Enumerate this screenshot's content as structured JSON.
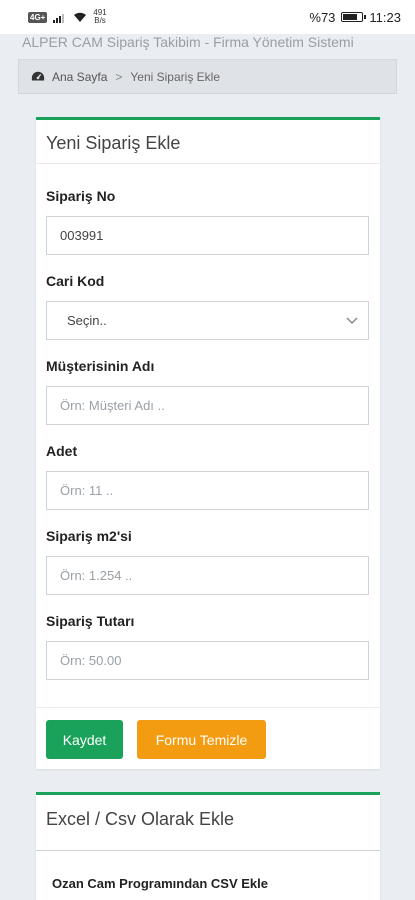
{
  "status_bar": {
    "sim_label": "4G+",
    "speed_value": "491",
    "speed_unit": "B/s",
    "battery": "%73",
    "time": "11:23",
    "battery_level": 0.73
  },
  "app_title": "ALPER CAM Sipariş Takibim - Firma Yönetim Sistemi",
  "breadcrumb": {
    "home": "Ana Sayfa",
    "separator": ">",
    "current": "Yeni Sipariş Ekle"
  },
  "order_form": {
    "title": "Yeni Sipariş Ekle",
    "fields": {
      "order_no": {
        "label": "Sipariş No",
        "value": "003991"
      },
      "account_code": {
        "label": "Cari Kod",
        "selected": "Seçin.."
      },
      "customer_name": {
        "label": "Müşterisinin Adı",
        "placeholder": "Örn: Müşteri Adı .."
      },
      "quantity": {
        "label": "Adet",
        "placeholder": "Örn: 11 .."
      },
      "area_m2": {
        "label": "Sipariş m2'si",
        "placeholder": "Örn: 1.254 .."
      },
      "amount": {
        "label": "Sipariş Tutarı",
        "placeholder": "Örn: 50.00"
      }
    },
    "buttons": {
      "save": "Kaydet",
      "clear": "Formu Temizle"
    }
  },
  "import_section": {
    "title": "Excel / Csv Olarak Ekle",
    "sub_title": "Ozan Cam Programından CSV Ekle"
  },
  "colors": {
    "accent_green": "#1aa25a",
    "accent_orange": "#f39c12",
    "page_bg": "#eaedf1"
  }
}
